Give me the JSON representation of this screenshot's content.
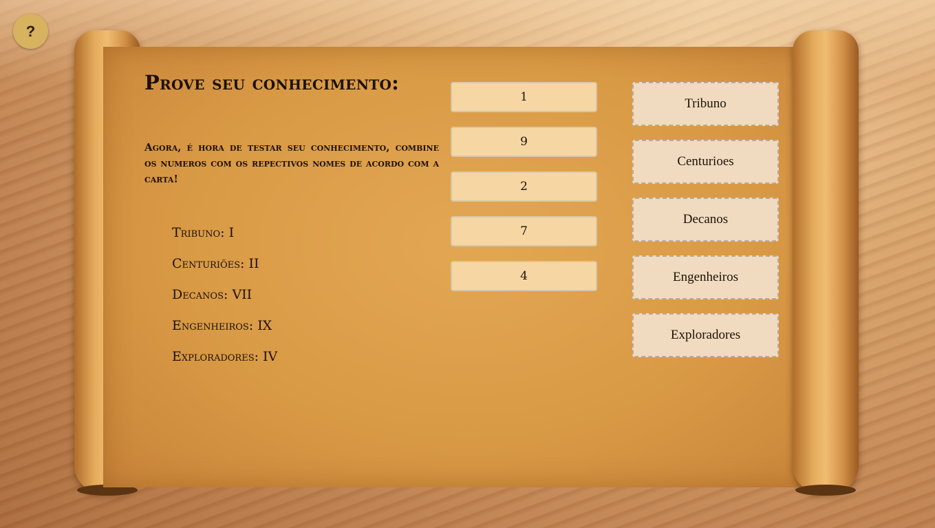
{
  "help": {
    "label": "?"
  },
  "title": "Prove seu conhecimento:",
  "instructions": "Agora, é hora de testar seu conhecimento, combine os numeros com os repectivos nomes de acordo com a carta!",
  "key": [
    "Tribuno: I",
    "Centuriões: II",
    "Decanos: VII",
    "Engenheiros: IX",
    "Exploradores: IV"
  ],
  "numbers": [
    "1",
    "9",
    "2",
    "7",
    "4"
  ],
  "slots": [
    "Tribuno",
    "Centurioes",
    "Decanos",
    "Engenheiros",
    "Exploradores"
  ]
}
